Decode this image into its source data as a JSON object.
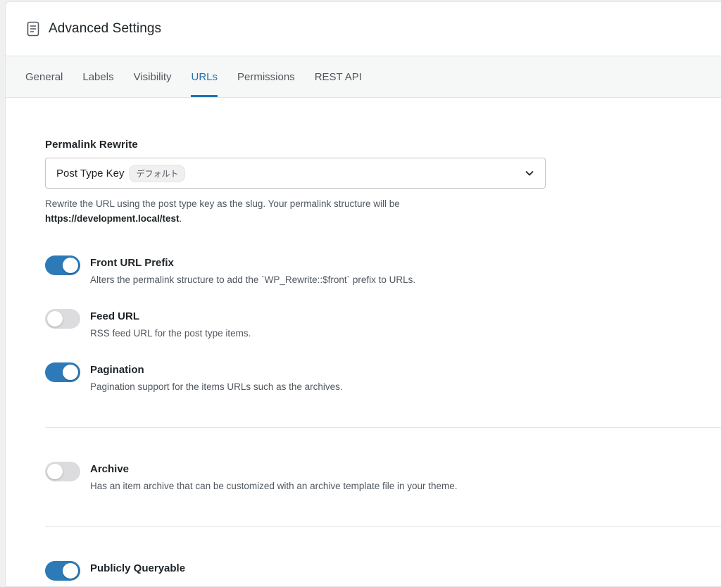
{
  "panel": {
    "title": "Advanced Settings",
    "icon": "document-icon"
  },
  "tabs": [
    {
      "label": "General",
      "active": false
    },
    {
      "label": "Labels",
      "active": false
    },
    {
      "label": "Visibility",
      "active": false
    },
    {
      "label": "URLs",
      "active": true
    },
    {
      "label": "Permissions",
      "active": false
    },
    {
      "label": "REST API",
      "active": false
    }
  ],
  "permalink": {
    "label": "Permalink Rewrite",
    "selected": "Post Type Key",
    "tag": "デフォルト",
    "help_prefix": "Rewrite the URL using the post type key as the slug. Your permalink structure will be",
    "help_url": "https://development.local/test",
    "help_suffix": "."
  },
  "toggles": [
    {
      "title": "Front URL Prefix",
      "description": "Alters the permalink structure to add the `WP_Rewrite::$front` prefix to URLs.",
      "on": true
    },
    {
      "title": "Feed URL",
      "description": "RSS feed URL for the post type items.",
      "on": false
    },
    {
      "title": "Pagination",
      "description": "Pagination support for the items URLs such as the archives.",
      "on": true
    },
    {
      "title": "Archive",
      "description": "Has an item archive that can be customized with an archive template file in your theme.",
      "on": false
    },
    {
      "title": "Publicly Queryable",
      "description": "",
      "on": true
    }
  ],
  "colors": {
    "accent": "#2271b1",
    "toggle_on": "#2d7ab9",
    "toggle_off": "#dcdcde"
  }
}
